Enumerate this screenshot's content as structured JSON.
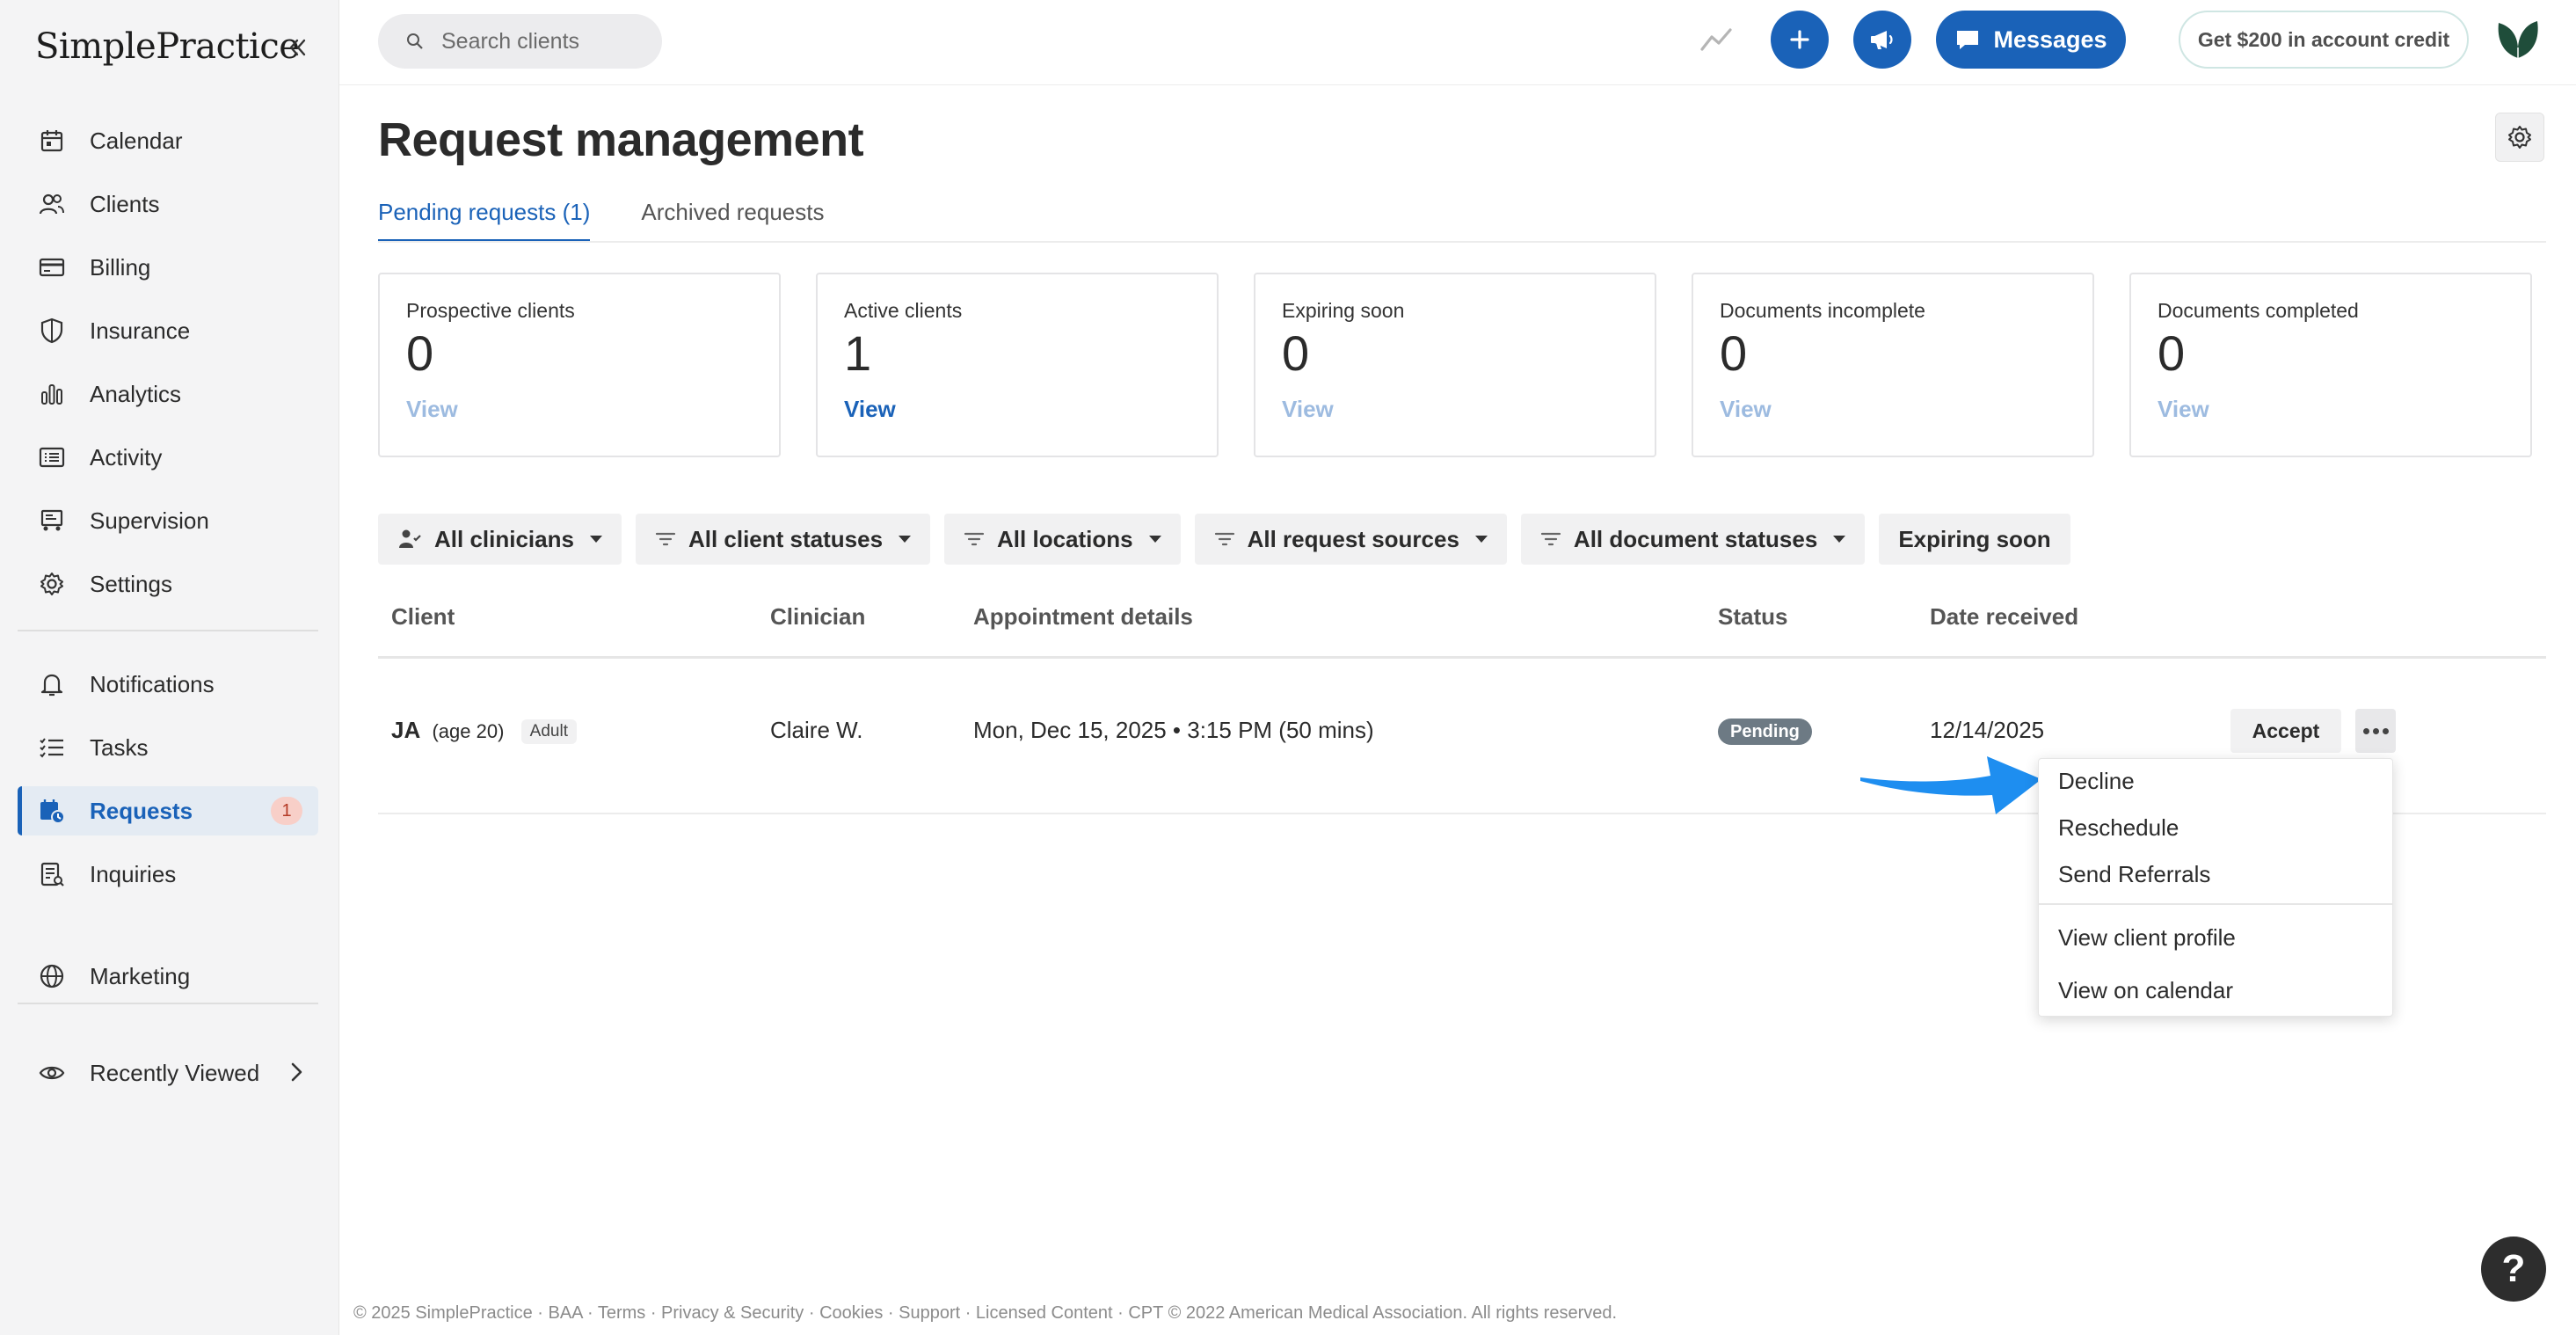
{
  "app": {
    "logo_text": "SimplePractice",
    "accent_color": "#1a62b8"
  },
  "sidebar": {
    "items": [
      {
        "label": "Calendar",
        "icon": "calendar-icon"
      },
      {
        "label": "Clients",
        "icon": "clients-icon"
      },
      {
        "label": "Billing",
        "icon": "billing-card-icon"
      },
      {
        "label": "Insurance",
        "icon": "shield-icon"
      },
      {
        "label": "Analytics",
        "icon": "bar-chart-icon"
      },
      {
        "label": "Activity",
        "icon": "activity-list-icon"
      },
      {
        "label": "Supervision",
        "icon": "supervision-icon"
      },
      {
        "label": "Settings",
        "icon": "gear-icon"
      },
      {
        "label": "Notifications",
        "icon": "bell-icon"
      },
      {
        "label": "Tasks",
        "icon": "tasks-icon"
      },
      {
        "label": "Requests",
        "icon": "requests-calendar-icon",
        "badge": "1",
        "active": true
      },
      {
        "label": "Inquiries",
        "icon": "inquiries-icon"
      },
      {
        "label": "Marketing",
        "icon": "globe-icon"
      },
      {
        "label": "Recently Viewed",
        "icon": "eye-icon"
      }
    ]
  },
  "topbar": {
    "search_placeholder": "Search clients",
    "messages_label": "Messages",
    "credit_label": "Get $200 in account credit"
  },
  "page": {
    "title": "Request management",
    "tabs": [
      {
        "label": "Pending requests (1)",
        "active": true
      },
      {
        "label": "Archived requests",
        "active": false
      }
    ],
    "cards": [
      {
        "label": "Prospective clients",
        "value": "0",
        "link": "View"
      },
      {
        "label": "Active clients",
        "value": "1",
        "link": "View"
      },
      {
        "label": "Expiring soon",
        "value": "0",
        "link": "View"
      },
      {
        "label": "Documents incomplete",
        "value": "0",
        "link": "View"
      },
      {
        "label": "Documents completed",
        "value": "0",
        "link": "View"
      }
    ],
    "filters": [
      "All clinicians",
      "All client statuses",
      "All locations",
      "All request sources",
      "All document statuses",
      "Expiring soon"
    ],
    "table": {
      "headers": [
        "Client",
        "Clinician",
        "Appointment details",
        "Status",
        "Date received"
      ],
      "rows": [
        {
          "client_initials": "JA",
          "client_age": "(age 20)",
          "client_type": "Adult",
          "clinician": "Claire W.",
          "appointment": "Mon, Dec 15, 2025 • 3:15 PM (50 mins)",
          "status": "Pending",
          "date_received": "12/14/2025",
          "accept_label": "Accept"
        }
      ]
    },
    "dropdown_menu": [
      "Decline",
      "Reschedule",
      "Send Referrals",
      "View client profile",
      "View on calendar"
    ]
  },
  "footer": {
    "text": "© 2025 SimplePractice · BAA · Terms · Privacy & Security · Cookies · Support · Licensed Content · CPT © 2022 American Medical Association. All rights reserved."
  },
  "help": {
    "label": "?"
  }
}
